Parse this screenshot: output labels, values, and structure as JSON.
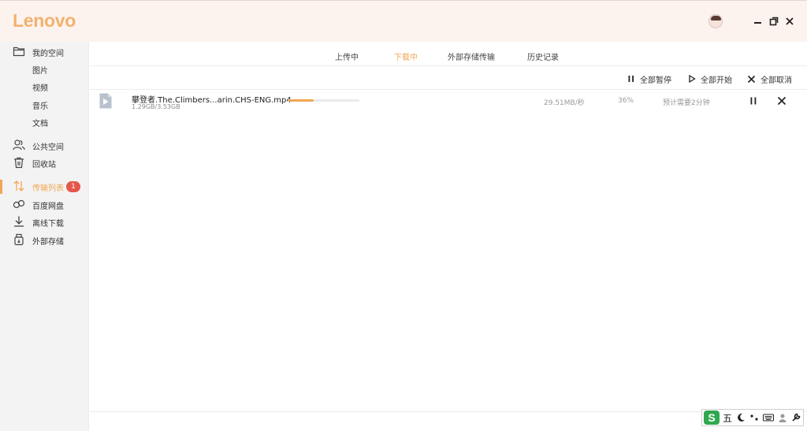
{
  "app": {
    "logo_text": "Lenovo",
    "accent_color": "#f0a754",
    "logo_color": "#f2b26f"
  },
  "window_controls": [
    {
      "name": "minimize",
      "icon": "minimize-icon"
    },
    {
      "name": "restore",
      "icon": "restore-icon"
    },
    {
      "name": "close",
      "icon": "close-icon"
    }
  ],
  "sidebar": {
    "items": [
      {
        "label": "我的空间",
        "icon": "folder-icon"
      },
      {
        "label": "图片"
      },
      {
        "label": "视频"
      },
      {
        "label": "音乐"
      },
      {
        "label": "文档"
      },
      {
        "label": "公共空间",
        "icon": "users-icon"
      },
      {
        "label": "回收站",
        "icon": "trash-icon"
      },
      {
        "label": "传输列表",
        "icon": "transfer-icon",
        "badge": "1",
        "active": true
      },
      {
        "label": "百度网盘",
        "icon": "baidu-cloud-icon"
      },
      {
        "label": "离线下载",
        "icon": "download-icon"
      },
      {
        "label": "外部存储",
        "icon": "usb-storage-icon"
      }
    ]
  },
  "tabs": [
    {
      "label": "上传中"
    },
    {
      "label": "下载中",
      "active": true
    },
    {
      "label": "外部存储传输"
    },
    {
      "label": "历史记录"
    }
  ],
  "toolbar": {
    "pause_all": "全部暂停",
    "start_all": "全部开始",
    "cancel_all": "全部取消"
  },
  "downloads": [
    {
      "file_name": "攀登者.The.Climbers...arin.CHS-ENG.mp4",
      "size_text": "1.29GB/3.53GB",
      "speed": "29.51MB/秒",
      "percent_text": "36%",
      "progress": 0.36,
      "eta": "预计需要2分钟",
      "icon": "video-file-icon"
    }
  ],
  "ime": {
    "logo": "S",
    "mode": "五"
  }
}
